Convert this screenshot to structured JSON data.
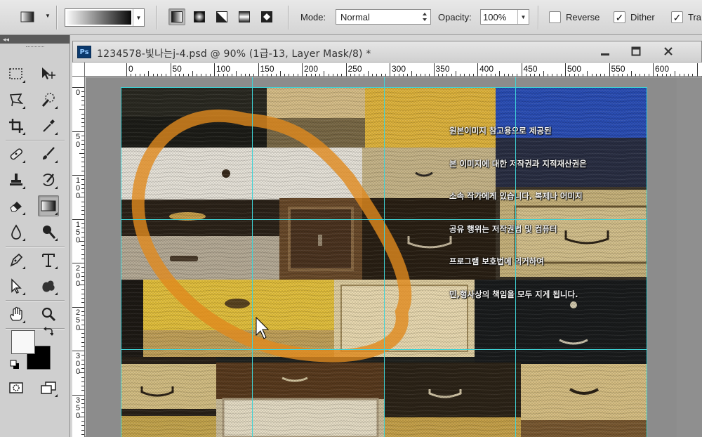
{
  "options_bar": {
    "mode_label": "Mode:",
    "mode_value": "Normal",
    "opacity_label": "Opacity:",
    "opacity_value": "100%",
    "reverse_label": "Reverse",
    "reverse_checked": false,
    "dither_label": "Dither",
    "dither_checked": true,
    "transparency_label": "Tra",
    "transparency_checked": true,
    "gradient_types": [
      "linear-gradient-icon",
      "radial-gradient-icon",
      "angle-gradient-icon",
      "reflected-gradient-icon",
      "diamond-gradient-icon"
    ],
    "active_gradient_type": "linear-gradient-icon"
  },
  "toolbox": {
    "collapse_label": "◂◂",
    "tools": [
      "rectangular-marquee-icon",
      "move-icon",
      "polygonal-lasso-icon",
      "quick-selection-icon",
      "crop-icon",
      "eyedropper-icon",
      "spot-healing-icon",
      "brush-icon",
      "clone-stamp-icon",
      "history-brush-icon",
      "eraser-icon",
      "gradient-icon",
      "blur-icon",
      "dodge-icon",
      "pen-icon",
      "type-icon",
      "path-selection-icon",
      "custom-shape-icon",
      "hand-icon",
      "zoom-icon"
    ],
    "active_tool": "gradient-icon",
    "foreground_color": "#f8f8f8",
    "background_color": "#000000"
  },
  "document": {
    "app_badge": "Ps",
    "title": "1234578-빛나는j-4.psd @ 90% (1급-13, Layer Mask/8) *"
  },
  "rulers": {
    "horizontal_labels": [
      "0",
      "50",
      "100",
      "150",
      "200",
      "250",
      "300",
      "350",
      "400",
      "450",
      "500",
      "550",
      "600"
    ],
    "vertical_labels": [
      "0",
      "5\n0",
      "1\n0\n0",
      "1\n5\n0",
      "2\n0\n0",
      "2\n5\n0",
      "3\n0\n0",
      "3\n5\n0"
    ]
  },
  "canvas": {
    "overlay_text_lines": [
      "원본이미지 참고용으로 제공된",
      "본 이미지에 대한 저작권과 지적재산권은",
      "소속 작가에게 있습니다. 복제나 어미지",
      "공유 행위는 저작권법 및 컴퓨터",
      "프로그램 보호법에 의거하여",
      "민,형사상의 책임을 모두 지게 됩니다."
    ],
    "brush_stroke_color": "#e08a1e"
  }
}
